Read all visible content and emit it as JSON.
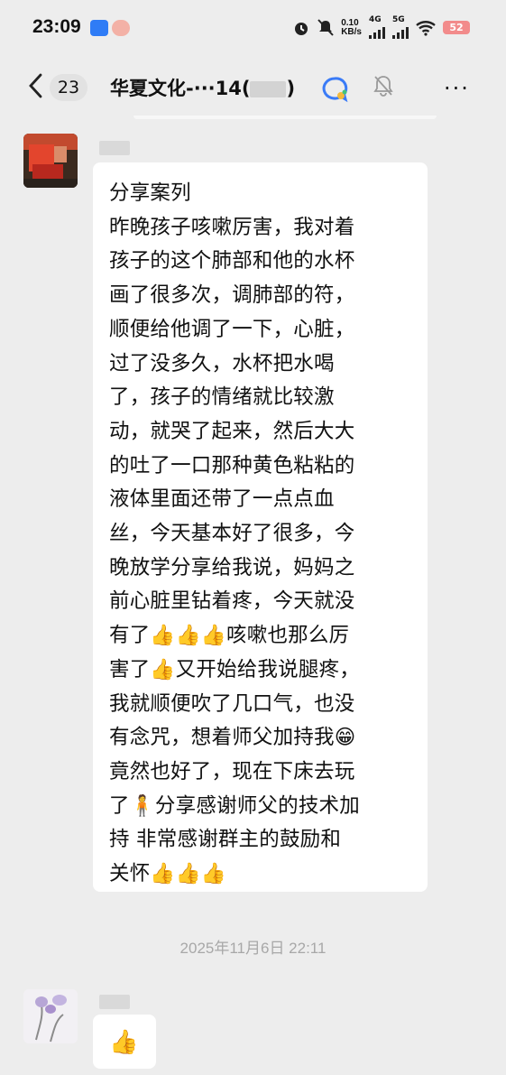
{
  "status_bar": {
    "time": "23:09",
    "net_speed_value": "0.10",
    "net_speed_unit": "KB/s",
    "signal1_label": "4G",
    "signal2_label": "5G",
    "battery": "52"
  },
  "header": {
    "unread_count": "23",
    "group_name_prefix": "华夏文化-···14(",
    "group_name_suffix": ")",
    "more_label": "···"
  },
  "messages": [
    {
      "text": "分享案列\n昨晚孩子咳嗽厉害，我对着\n孩子的这个肺部和他的水杯\n画了很多次，调肺部的符，\n顺便给他调了一下，心脏，\n过了没多久，水杯把水喝\n了，孩子的情绪就比较激\n动，就哭了起来，然后大大\n的吐了一口那种黄色粘粘的\n液体里面还带了一点点血\n丝，今天基本好了很多，今\n晚放学分享给我说，妈妈之\n前心脏里钻着疼，今天就没\n有了👍👍👍咳嗽也那么厉\n害了👍又开始给我说腿疼，\n我就顺便吹了几口气，也没\n有念咒，想着师父加持我😁\n竟然也好了，现在下床去玩\n了🧍分享感谢师父的技术加\n持 非常感谢群主的鼓励和\n关怀👍👍👍"
    },
    {
      "text": "👍"
    }
  ],
  "timestamp": "2025年11月6日 22:11"
}
